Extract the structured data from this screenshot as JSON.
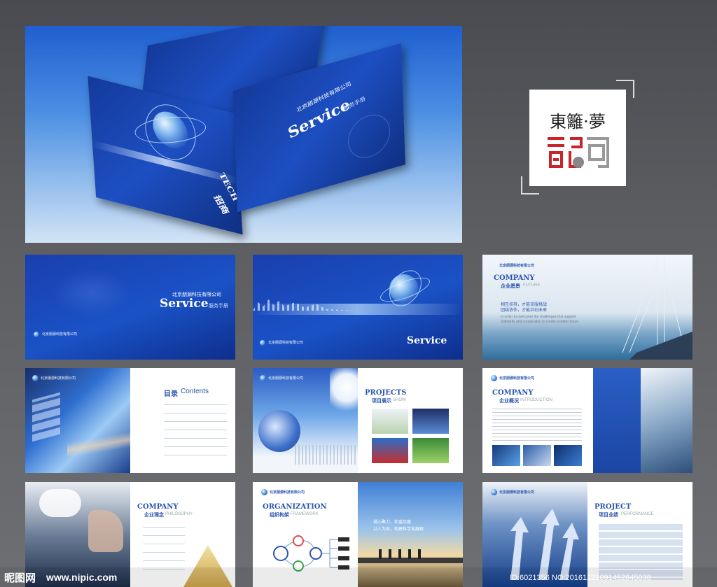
{
  "hero": {
    "company_cn": "北京朋源科技有限公司",
    "service_word": "Service",
    "service_cn": "服务手册",
    "side_text_1": "TECH",
    "side_text_2": "招商"
  },
  "logo": {
    "line1": "東籬·夢"
  },
  "pages": {
    "p1": {
      "company_cn": "北京朋源科技有限公司",
      "service_word": "Service",
      "service_cn": "服务手册",
      "footer_company": "北京朋源科技有限公司"
    },
    "p2": {
      "service_word": "Service",
      "footer_company": "北京朋源科技有限公司"
    },
    "p3": {
      "company_cn": "北京朋源科技有限公司",
      "title_en": "COMPANY",
      "title_cn": "企业愿景",
      "title_sub": "FUTURE",
      "cn_1": "相互扶持，才能克服挑战",
      "cn_2": "团结协作，才能共创未来",
      "en_1": "In order to overcome the challenges that support",
      "en_2": "Solidarity and cooperation to create a better future"
    },
    "p4": {
      "company_cn": "北京朋源科技有限公司",
      "title_cn": "目录",
      "title_en": "Contents"
    },
    "p5": {
      "company_cn": "北京朋源科技有限公司",
      "title_en": "PROJECTS",
      "title_cn": "项目展示",
      "title_sub": "SHOW"
    },
    "p6": {
      "company_cn": "北京朋源科技有限公司",
      "title_en": "COMPANY",
      "title_cn": "企业概况",
      "title_sub": "INTRODUCTION"
    },
    "p7": {
      "company_cn": "北京朋源科技有限公司",
      "title_en": "COMPANY",
      "title_cn": "企业理念",
      "title_sub": "PHILOSOPHY"
    },
    "p8": {
      "company_cn": "北京朋源科技有限公司",
      "title_en": "ORGANIZATION",
      "title_cn": "组织构架",
      "title_sub": "FRAMEWORK",
      "slogan_1": "凝心聚力，和谐共赢",
      "slogan_2": "以人为本，构建科学发展观"
    },
    "p9": {
      "company_cn": "北京朋源科技有限公司",
      "title_en": "PROJECT",
      "title_cn": "项目业绩",
      "title_sub": "PERFORMANCE"
    }
  },
  "watermark": {
    "site_cn": "昵图网",
    "site_url": "www.nipic.com",
    "id_text": "ID:6021356 NO:20161221091452845038"
  }
}
